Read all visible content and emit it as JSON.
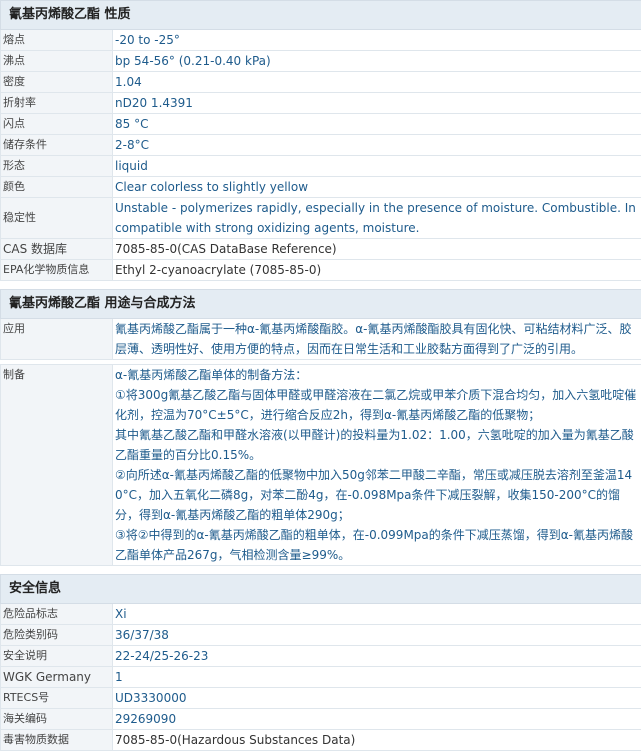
{
  "props": {
    "header_name": "氰基丙烯酸乙酯",
    "header_section": "性质",
    "rows": [
      {
        "k": "熔点",
        "v": "-20 to -25°"
      },
      {
        "k": "沸点",
        "v": "bp 54-56° (0.21-0.40 kPa)"
      },
      {
        "k": "密度",
        "v": "1.04"
      },
      {
        "k": "折射率",
        "v": "nD20 1.4391"
      },
      {
        "k": "闪点",
        "v": "85 °C"
      },
      {
        "k": "储存条件",
        "v": "2-8°C"
      },
      {
        "k": "形态",
        "v": "liquid"
      },
      {
        "k": "颜色",
        "v": "Clear colorless to slightly yellow"
      }
    ],
    "stability_key": "稳定性",
    "stability_val": "Unstable - polymerizes rapidly, especially in the presence of moisture. Combustible. Incompatible with strong oxidizing agents, moisture.",
    "cas_key": "CAS 数据库",
    "cas_val": "7085-85-0(CAS DataBase Reference)",
    "epa_key": "EPA化学物质信息",
    "epa_val": "Ethyl 2-cyanoacrylate (7085-85-0)"
  },
  "usage": {
    "header_name": "氰基丙烯酸乙酯",
    "header_section": "用途与合成方法",
    "app_key": "应用",
    "app_val": "氰基丙烯酸乙酯属于一种α-氰基丙烯酸酯胶。α-氰基丙烯酸酯胶具有固化快、可粘结材料广泛、胶层薄、透明性好、使用方便的特点，因而在日常生活和工业胶黏方面得到了广泛的引用。",
    "prep_key": "制备",
    "prep_lines": [
      "α-氰基丙烯酸乙酯单体的制备方法：",
      "①将300g氰基乙酸乙酯与固体甲醛或甲醛溶液在二氯乙烷或甲苯介质下混合均匀，加入六氢吡啶催化剂，控温为70°C±5°C，进行缩合反应2h，得到α-氰基丙烯酸乙酯的低聚物；",
      "其中氰基乙酸乙酯和甲醛水溶液(以甲醛计)的投料量为1.02：1.00，六氢吡啶的加入量为氰基乙酸乙酯重量的百分比0.15%。",
      "②向所述α-氰基丙烯酸乙酯的低聚物中加入50g邻苯二甲酸二辛酯，常压或减压脱去溶剂至釜温140°C，加入五氧化二磷8g，对苯二酚4g，在-0.098Mpa条件下减压裂解，收集150-200°C的馏分，得到α-氰基丙烯酸乙酯的粗单体290g；",
      "③将②中得到的α-氰基丙烯酸乙酯的粗单体，在-0.099Mpa的条件下减压蒸馏，得到α-氰基丙烯酸乙酯单体产品267g，气相检测含量≥99%。"
    ]
  },
  "safety": {
    "header": "安全信息",
    "rows": [
      {
        "k": "危险品标志",
        "v": "Xi"
      },
      {
        "k": "危险类别码",
        "v": "36/37/38"
      },
      {
        "k": "安全说明",
        "v": "22-24/25-26-23"
      },
      {
        "k": "WGK Germany",
        "v": "1"
      },
      {
        "k": "RTECS号",
        "v": "UD3330000"
      },
      {
        "k": "海关编码",
        "v": "29269090"
      },
      {
        "k": "毒害物质数据",
        "v": "7085-85-0(Hazardous Substances Data)"
      }
    ]
  }
}
